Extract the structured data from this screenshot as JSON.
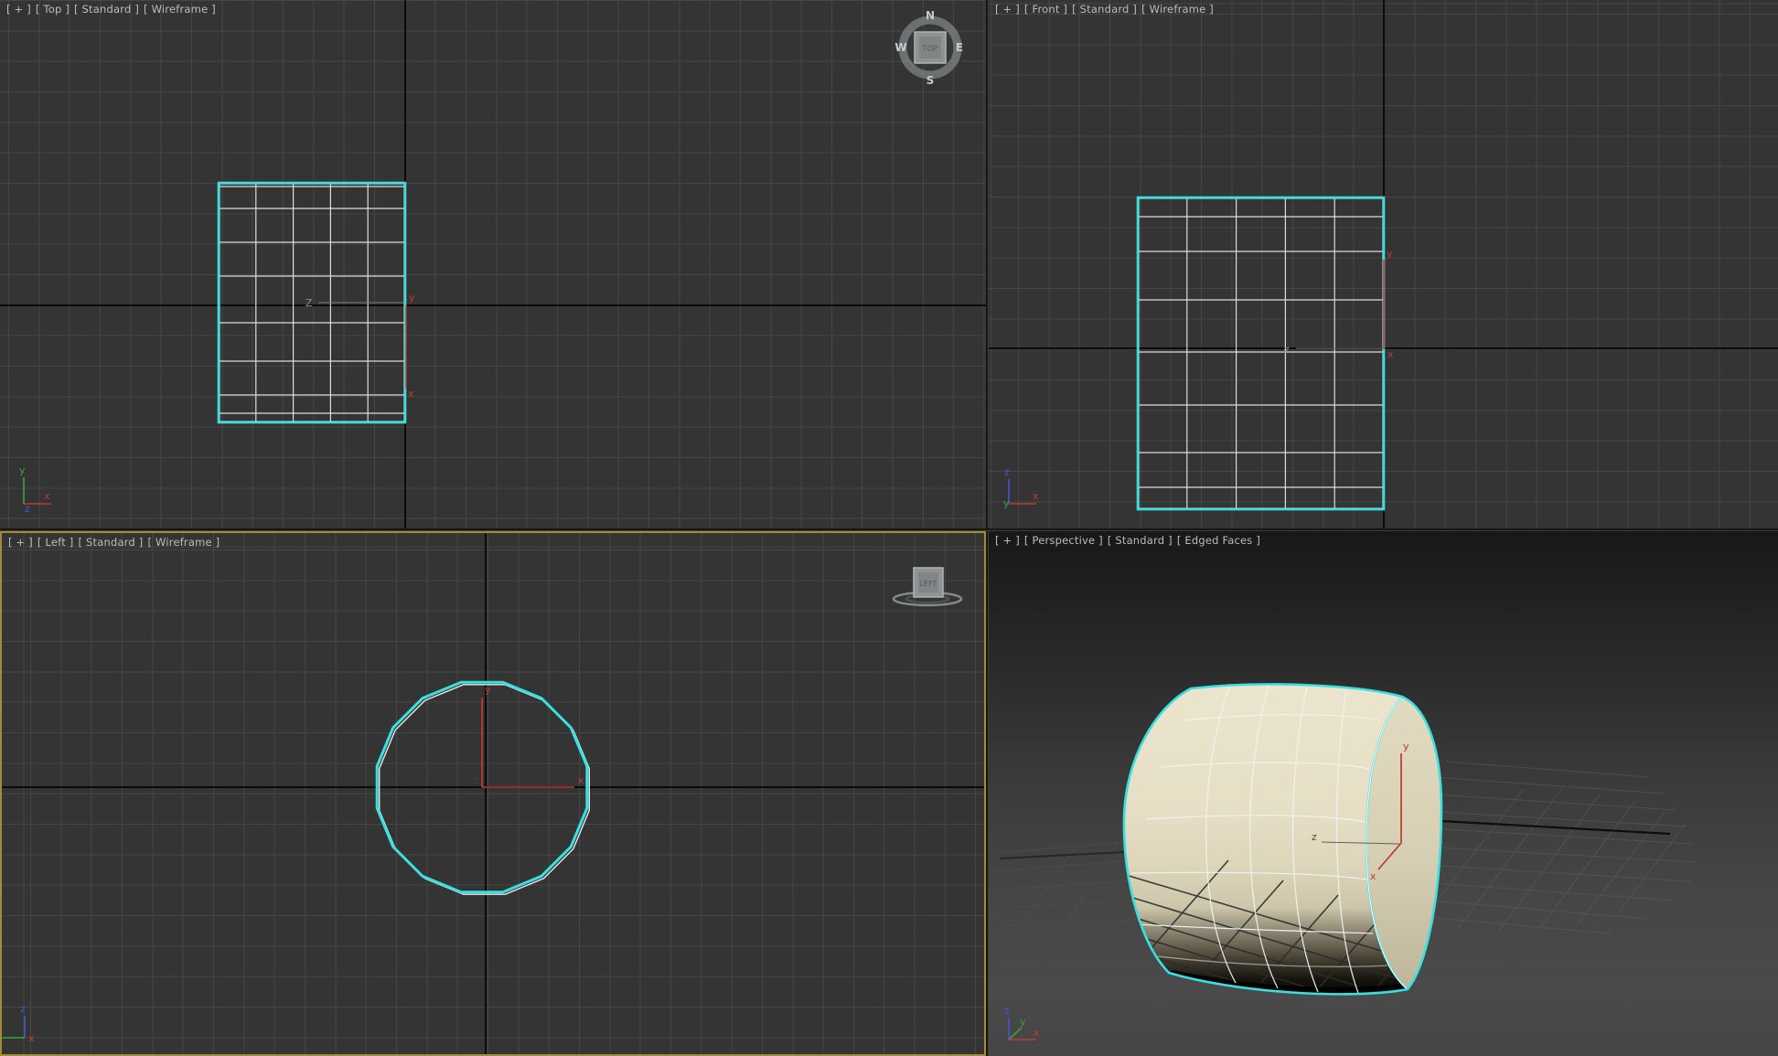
{
  "viewports": {
    "top": {
      "menu": "[ + ]",
      "view": "[ Top ]",
      "renderer": "[ Standard ]",
      "shading": "[ Wireframe ]"
    },
    "front": {
      "menu": "[ + ]",
      "view": "[ Front ]",
      "renderer": "[ Standard ]",
      "shading": "[ Wireframe ]"
    },
    "left": {
      "menu": "[ + ]",
      "view": "[ Left ]",
      "renderer": "[ Standard ]",
      "shading": "[ Wireframe ]"
    },
    "perspective": {
      "menu": "[ + ]",
      "view": "[ Perspective ]",
      "renderer": "[ Standard ]",
      "shading": "[ Edged Faces ]"
    }
  },
  "viewcube": {
    "top_face": "TOP",
    "left_face": "LEFT",
    "north": "N",
    "east": "E",
    "south": "S",
    "west": "W"
  },
  "axis_labels": {
    "x": "x",
    "y": "y",
    "z": "z",
    "z_upper": "Z"
  },
  "colors": {
    "selection_cyan": "#38e0e0",
    "wireframe_white": "#e9e9e9",
    "active_viewport_border": "#a28c34",
    "axis_x_red": "#c23b31",
    "axis_y_green": "#3ba13b",
    "axis_z_blue": "#4753d8",
    "viewport_background": "#343434",
    "grid_line": "#464646",
    "world_axis": "#0b0b0b",
    "cylinder_top": "#eae3cb",
    "cylinder_shadow": "#4a4536"
  }
}
